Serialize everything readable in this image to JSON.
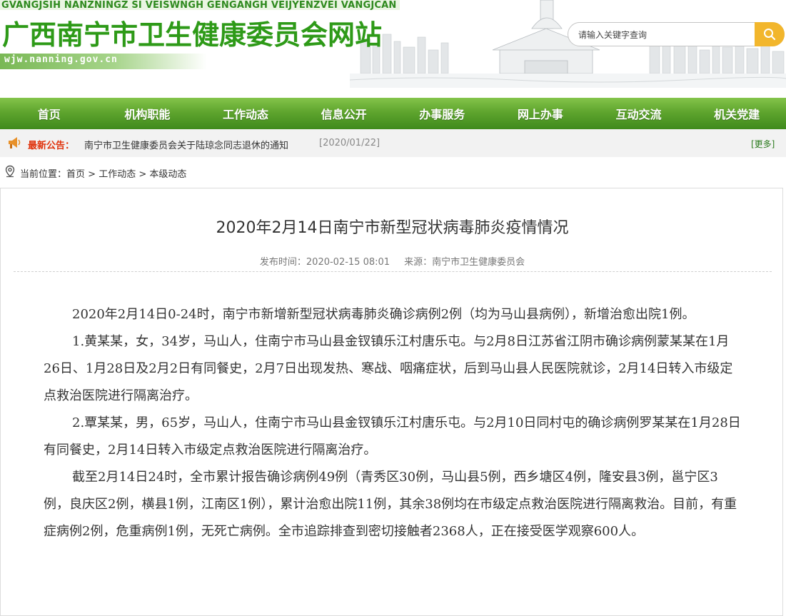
{
  "header": {
    "subtitle": "GVANGJSIH NANZNINGZ SI VEISWNGH GENGANGH VEIJYENZVEI VANGJCAN",
    "title": "广西南宁市卫生健康委员会网站",
    "domain": "wjw.nanning.gov.cn",
    "search_placeholder": "请输入关键字查询",
    "search_icon": "magnifier-icon"
  },
  "nav": {
    "items": [
      "首页",
      "机构职能",
      "工作动态",
      "信息公开",
      "办事服务",
      "网上办事",
      "互动交流",
      "机关党建"
    ]
  },
  "notice": {
    "label": "最新公告：",
    "link": "南宁市卫生健康委员会关于陆琼念同志退休的通知",
    "date": "[2020/01/22]",
    "more": "[更多]",
    "icon": "megaphone-icon"
  },
  "breadcrumb": {
    "prefix": "当前位置：",
    "items": [
      "首页",
      "工作动态",
      "本级动态"
    ],
    "separator": " > ",
    "icon": "location-pin-icon"
  },
  "article": {
    "title": "2020年2月14日南宁市新型冠状病毒肺炎疫情情况",
    "publish_time": "发布时间：2020-02-15 08:01",
    "source": "来源：南宁市卫生健康委员会",
    "paragraphs": [
      "2020年2月14日0-24时，南宁市新增新型冠状病毒肺炎确诊病例2例（均为马山县病例），新增治愈出院1例。",
      "1.黄某某，女，34岁，马山人，住南宁市马山县金钗镇乐江村唐乐屯。与2月8日江苏省江阴市确诊病例蒙某某在1月26日、1月28日及2月2日有同餐史，2月7日出现发热、寒战、咽痛症状，后到马山县人民医院就诊，2月14日转入市级定点救治医院进行隔离治疗。",
      "2.覃某某，男，65岁，马山人，住南宁市马山县金钗镇乐江村唐乐屯。与2月10日同村屯的确诊病例罗某某在1月28日有同餐史，2月14日转入市级定点救治医院进行隔离治疗。",
      "截至2月14日24时，全市累计报告确诊病例49例（青秀区30例，马山县5例，西乡塘区4例，隆安县3例，邕宁区3例，良庆区2例，横县1例，江南区1例），累计治愈出院11例，其余38例均在市级定点救治医院进行隔离救治。目前，有重症病例2例，危重病例1例，无死亡病例。全市追踪排查到密切接触者2368人，正在接受医学观察600人。"
    ]
  },
  "colors": {
    "title_green": "#2e9a18",
    "nav_green": "#5fa52e",
    "notice_red": "#e0320b",
    "search_yellow": "#f2b62c"
  }
}
